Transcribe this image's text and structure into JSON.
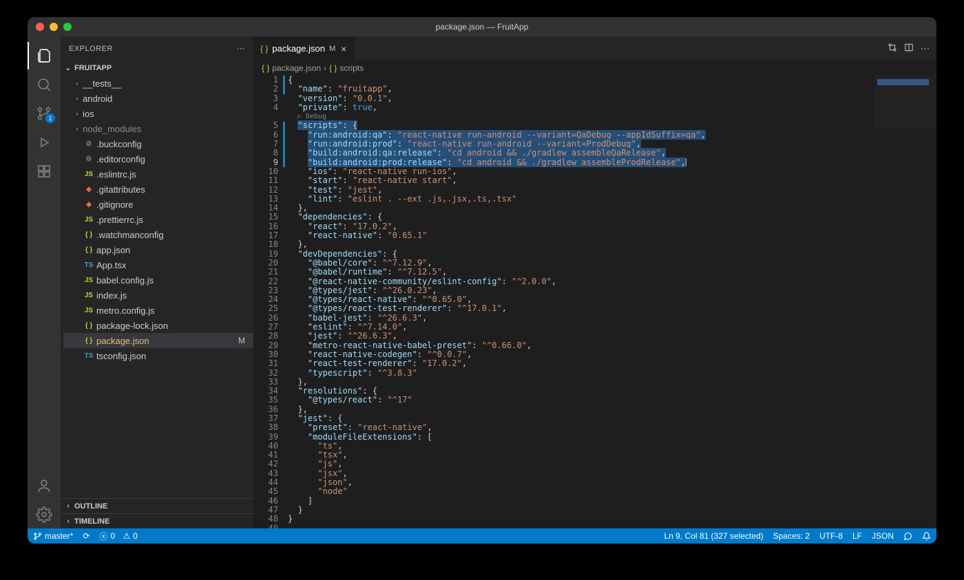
{
  "window": {
    "title": "package.json — FruitApp"
  },
  "activitybar": {
    "items": [
      "explorer",
      "search",
      "scm",
      "debug",
      "extensions"
    ],
    "scm_badge": "1"
  },
  "sidebar": {
    "title": "EXPLORER",
    "project": "FRUITAPP",
    "folders": [
      {
        "name": "__tests__"
      },
      {
        "name": "android"
      },
      {
        "name": "ios"
      },
      {
        "name": "node_modules",
        "dim": true
      }
    ],
    "files": [
      {
        "name": ".buckconfig",
        "icon": "cfg"
      },
      {
        "name": ".editorconfig",
        "icon": "cfg"
      },
      {
        "name": ".eslintrc.js",
        "icon": "js"
      },
      {
        "name": ".gitattributes",
        "icon": "git"
      },
      {
        "name": ".gitignore",
        "icon": "git"
      },
      {
        "name": ".prettierrc.js",
        "icon": "js"
      },
      {
        "name": ".watchmanconfig",
        "icon": "json"
      },
      {
        "name": "app.json",
        "icon": "json"
      },
      {
        "name": "App.tsx",
        "icon": "ts"
      },
      {
        "name": "babel.config.js",
        "icon": "js"
      },
      {
        "name": "index.js",
        "icon": "js"
      },
      {
        "name": "metro.config.js",
        "icon": "js"
      },
      {
        "name": "package-lock.json",
        "icon": "json"
      },
      {
        "name": "package.json",
        "icon": "json",
        "selected": true,
        "modified": true
      },
      {
        "name": "tsconfig.json",
        "icon": "ts"
      }
    ],
    "outline": "OUTLINE",
    "timeline": "TIMELINE"
  },
  "tab": {
    "name": "package.json",
    "mod": "M"
  },
  "breadcrumb": {
    "file": "package.json",
    "path": "scripts"
  },
  "code": {
    "debug_lens": "Debug",
    "lines": [
      {
        "n": 1,
        "t": [
          {
            "p": "{"
          }
        ]
      },
      {
        "n": 2,
        "t": [
          {
            "sp": 2
          },
          {
            "k": "\"name\""
          },
          {
            "p": ": "
          },
          {
            "s": "\"fruitapp\""
          },
          {
            "p": ","
          }
        ]
      },
      {
        "n": 3,
        "t": [
          {
            "sp": 2
          },
          {
            "k": "\"version\""
          },
          {
            "p": ": "
          },
          {
            "s": "\"0.0.1\""
          },
          {
            "p": ","
          }
        ]
      },
      {
        "n": 4,
        "t": [
          {
            "sp": 2
          },
          {
            "k": "\"private\""
          },
          {
            "p": ": "
          },
          {
            "c": "true"
          },
          {
            "p": ","
          }
        ]
      },
      {
        "lens": true
      },
      {
        "n": 5,
        "t": [
          {
            "sp": 2
          },
          {
            "sel": true,
            "seg": [
              {
                "k": "\"scripts\""
              },
              {
                "p": ": {"
              }
            ]
          }
        ]
      },
      {
        "n": 6,
        "t": [
          {
            "sp": 4
          },
          {
            "sel": true,
            "seg": [
              {
                "k": "\"run:android:qa\""
              },
              {
                "p": ": "
              },
              {
                "s": "\"react-native run-android --variant=QaDebug --appIdSuffix=qa\""
              },
              {
                "p": ","
              }
            ]
          }
        ]
      },
      {
        "n": 7,
        "t": [
          {
            "sp": 4
          },
          {
            "sel": true,
            "seg": [
              {
                "k": "\"run:android:prod\""
              },
              {
                "p": ": "
              },
              {
                "s": "\"react-native run-android --variant=ProdDebug\""
              },
              {
                "p": ","
              }
            ]
          }
        ]
      },
      {
        "n": 8,
        "t": [
          {
            "sp": 4
          },
          {
            "sel": true,
            "seg": [
              {
                "k": "\"build:android:qa:release\""
              },
              {
                "p": ": "
              },
              {
                "s": "\"cd android && ./gradlew assembleQaRelease\""
              },
              {
                "p": ","
              }
            ]
          }
        ]
      },
      {
        "n": 9,
        "t": [
          {
            "sp": 4
          },
          {
            "sel": true,
            "seg": [
              {
                "k": "\"build:android:prod:release\""
              },
              {
                "p": ": "
              },
              {
                "s": "\"cd android && ./gradlew assembleProdRelease\""
              },
              {
                "p": ","
              }
            ]
          },
          {
            "caret": true
          }
        ],
        "cur": true
      },
      {
        "n": 10,
        "t": [
          {
            "sp": 4
          },
          {
            "k": "\"ios\""
          },
          {
            "p": ": "
          },
          {
            "s": "\"react-native run-ios\""
          },
          {
            "p": ","
          }
        ]
      },
      {
        "n": 11,
        "t": [
          {
            "sp": 4
          },
          {
            "k": "\"start\""
          },
          {
            "p": ": "
          },
          {
            "s": "\"react-native start\""
          },
          {
            "p": ","
          }
        ]
      },
      {
        "n": 12,
        "t": [
          {
            "sp": 4
          },
          {
            "k": "\"test\""
          },
          {
            "p": ": "
          },
          {
            "s": "\"jest\""
          },
          {
            "p": ","
          }
        ]
      },
      {
        "n": 13,
        "t": [
          {
            "sp": 4
          },
          {
            "k": "\"lint\""
          },
          {
            "p": ": "
          },
          {
            "s": "\"eslint . --ext .js,.jsx,.ts,.tsx\""
          }
        ]
      },
      {
        "n": 14,
        "t": [
          {
            "sp": 2
          },
          {
            "p": "},"
          }
        ]
      },
      {
        "n": 15,
        "t": [
          {
            "sp": 2
          },
          {
            "k": "\"dependencies\""
          },
          {
            "p": ": {"
          }
        ]
      },
      {
        "n": 16,
        "t": [
          {
            "sp": 4
          },
          {
            "k": "\"react\""
          },
          {
            "p": ": "
          },
          {
            "s": "\"17.0.2\""
          },
          {
            "p": ","
          }
        ]
      },
      {
        "n": 17,
        "t": [
          {
            "sp": 4
          },
          {
            "k": "\"react-native\""
          },
          {
            "p": ": "
          },
          {
            "s": "\"0.65.1\""
          }
        ]
      },
      {
        "n": 18,
        "t": [
          {
            "sp": 2
          },
          {
            "p": "},"
          }
        ]
      },
      {
        "n": 19,
        "t": [
          {
            "sp": 2
          },
          {
            "k": "\"devDependencies\""
          },
          {
            "p": ": {"
          }
        ]
      },
      {
        "n": 20,
        "t": [
          {
            "sp": 4
          },
          {
            "k": "\"@babel/core\""
          },
          {
            "p": ": "
          },
          {
            "s": "\"^7.12.9\""
          },
          {
            "p": ","
          }
        ]
      },
      {
        "n": 21,
        "t": [
          {
            "sp": 4
          },
          {
            "k": "\"@babel/runtime\""
          },
          {
            "p": ": "
          },
          {
            "s": "\"^7.12.5\""
          },
          {
            "p": ","
          }
        ]
      },
      {
        "n": 22,
        "t": [
          {
            "sp": 4
          },
          {
            "k": "\"@react-native-community/eslint-config\""
          },
          {
            "p": ": "
          },
          {
            "s": "\"^2.0.0\""
          },
          {
            "p": ","
          }
        ]
      },
      {
        "n": 23,
        "t": [
          {
            "sp": 4
          },
          {
            "k": "\"@types/jest\""
          },
          {
            "p": ": "
          },
          {
            "s": "\"^26.0.23\""
          },
          {
            "p": ","
          }
        ]
      },
      {
        "n": 24,
        "t": [
          {
            "sp": 4
          },
          {
            "k": "\"@types/react-native\""
          },
          {
            "p": ": "
          },
          {
            "s": "\"^0.65.0\""
          },
          {
            "p": ","
          }
        ]
      },
      {
        "n": 25,
        "t": [
          {
            "sp": 4
          },
          {
            "k": "\"@types/react-test-renderer\""
          },
          {
            "p": ": "
          },
          {
            "s": "\"^17.0.1\""
          },
          {
            "p": ","
          }
        ]
      },
      {
        "n": 26,
        "t": [
          {
            "sp": 4
          },
          {
            "k": "\"babel-jest\""
          },
          {
            "p": ": "
          },
          {
            "s": "\"^26.6.3\""
          },
          {
            "p": ","
          }
        ]
      },
      {
        "n": 27,
        "t": [
          {
            "sp": 4
          },
          {
            "k": "\"eslint\""
          },
          {
            "p": ": "
          },
          {
            "s": "\"^7.14.0\""
          },
          {
            "p": ","
          }
        ]
      },
      {
        "n": 28,
        "t": [
          {
            "sp": 4
          },
          {
            "k": "\"jest\""
          },
          {
            "p": ": "
          },
          {
            "s": "\"^26.6.3\""
          },
          {
            "p": ","
          }
        ]
      },
      {
        "n": 29,
        "t": [
          {
            "sp": 4
          },
          {
            "k": "\"metro-react-native-babel-preset\""
          },
          {
            "p": ": "
          },
          {
            "s": "\"^0.66.0\""
          },
          {
            "p": ","
          }
        ]
      },
      {
        "n": 30,
        "t": [
          {
            "sp": 4
          },
          {
            "k": "\"react-native-codegen\""
          },
          {
            "p": ": "
          },
          {
            "s": "\"^0.0.7\""
          },
          {
            "p": ","
          }
        ]
      },
      {
        "n": 31,
        "t": [
          {
            "sp": 4
          },
          {
            "k": "\"react-test-renderer\""
          },
          {
            "p": ": "
          },
          {
            "s": "\"17.0.2\""
          },
          {
            "p": ","
          }
        ]
      },
      {
        "n": 32,
        "t": [
          {
            "sp": 4
          },
          {
            "k": "\"typescript\""
          },
          {
            "p": ": "
          },
          {
            "s": "\"^3.8.3\""
          }
        ]
      },
      {
        "n": 33,
        "t": [
          {
            "sp": 2
          },
          {
            "p": "},"
          }
        ]
      },
      {
        "n": 34,
        "t": [
          {
            "sp": 2
          },
          {
            "k": "\"resolutions\""
          },
          {
            "p": ": {"
          }
        ]
      },
      {
        "n": 35,
        "t": [
          {
            "sp": 4
          },
          {
            "k": "\"@types/react\""
          },
          {
            "p": ": "
          },
          {
            "s": "\"^17\""
          }
        ]
      },
      {
        "n": 36,
        "t": [
          {
            "sp": 2
          },
          {
            "p": "},"
          }
        ]
      },
      {
        "n": 37,
        "t": [
          {
            "sp": 2
          },
          {
            "k": "\"jest\""
          },
          {
            "p": ": {"
          }
        ]
      },
      {
        "n": 38,
        "t": [
          {
            "sp": 4
          },
          {
            "k": "\"preset\""
          },
          {
            "p": ": "
          },
          {
            "s": "\"react-native\""
          },
          {
            "p": ","
          }
        ]
      },
      {
        "n": 39,
        "t": [
          {
            "sp": 4
          },
          {
            "k": "\"moduleFileExtensions\""
          },
          {
            "p": ": ["
          }
        ]
      },
      {
        "n": 40,
        "t": [
          {
            "sp": 6
          },
          {
            "s": "\"ts\""
          },
          {
            "p": ","
          }
        ]
      },
      {
        "n": 41,
        "t": [
          {
            "sp": 6
          },
          {
            "s": "\"tsx\""
          },
          {
            "p": ","
          }
        ]
      },
      {
        "n": 42,
        "t": [
          {
            "sp": 6
          },
          {
            "s": "\"js\""
          },
          {
            "p": ","
          }
        ]
      },
      {
        "n": 43,
        "t": [
          {
            "sp": 6
          },
          {
            "s": "\"jsx\""
          },
          {
            "p": ","
          }
        ]
      },
      {
        "n": 44,
        "t": [
          {
            "sp": 6
          },
          {
            "s": "\"json\""
          },
          {
            "p": ","
          }
        ]
      },
      {
        "n": 45,
        "t": [
          {
            "sp": 6
          },
          {
            "s": "\"node\""
          }
        ]
      },
      {
        "n": 46,
        "t": [
          {
            "sp": 4
          },
          {
            "p": "]"
          }
        ]
      },
      {
        "n": 47,
        "t": [
          {
            "sp": 2
          },
          {
            "p": "}"
          }
        ]
      },
      {
        "n": 48,
        "t": [
          {
            "p": "}"
          }
        ]
      },
      {
        "n": 49,
        "t": []
      }
    ]
  },
  "status": {
    "branch": "master*",
    "sync": "⟳",
    "errors": "0",
    "warnings": "0",
    "cursor": "Ln 9, Col 81 (327 selected)",
    "spaces": "Spaces: 2",
    "encoding": "UTF-8",
    "eol": "LF",
    "lang": "JSON"
  }
}
